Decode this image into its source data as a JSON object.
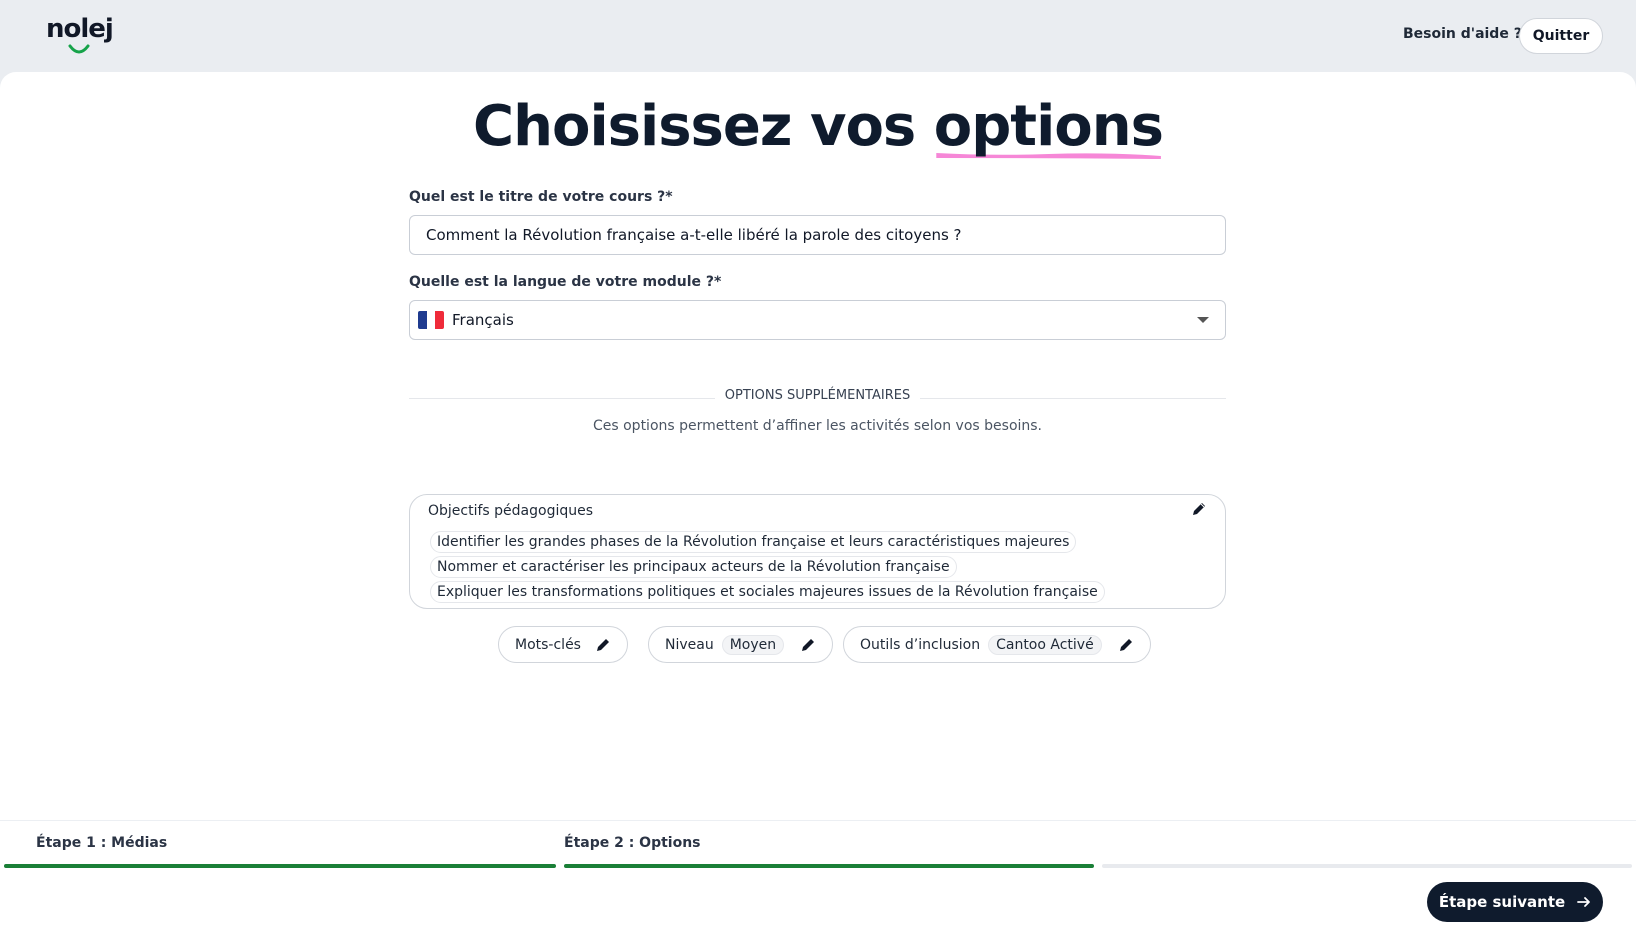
{
  "header": {
    "logo": "nolej",
    "help_link": "Besoin d'aide ?",
    "quit_button": "Quitter"
  },
  "page": {
    "title_prefix": "Choisissez vos",
    "title_highlight": "options",
    "highlight_color": "#f472d0"
  },
  "form": {
    "course_title_label": "Quel est le titre de votre cours ?*",
    "course_title_value": "Comment la Révolution française a-t-elle libéré la parole des citoyens ?",
    "language_label": "Quelle est la langue de votre module ?*",
    "language_value": "Français",
    "language_flag": "flag-fr-icon"
  },
  "extra_options": {
    "heading": "OPTIONS SUPPLÉMENTAIRES",
    "subtitle": "Ces options permettent d’affiner les activités selon vos besoins.",
    "objectives": {
      "title": "Objectifs pédagogiques",
      "items": [
        "Identifier les grandes phases de la Révolution française et leurs caractéristiques majeures",
        "Nommer et caractériser les principaux acteurs de la Révolution française",
        "Expliquer les transformations politiques et sociales majeures issues de la Révolution française"
      ]
    },
    "pills": {
      "keywords": {
        "label": "Mots-clés"
      },
      "level": {
        "label": "Niveau",
        "value": "Moyen"
      },
      "inclusion": {
        "label": "Outils d’inclusion",
        "value": "Cantoo Activé"
      }
    }
  },
  "steps": {
    "items": [
      {
        "label": "Étape 1 : Médias",
        "status": "complete"
      },
      {
        "label": "Étape 2 : Options",
        "status": "complete"
      },
      {
        "label": "",
        "status": "pending"
      }
    ],
    "complete_color": "#1a7f37",
    "pending_color": "#e8eaee",
    "next_button": "Étape suivante"
  }
}
